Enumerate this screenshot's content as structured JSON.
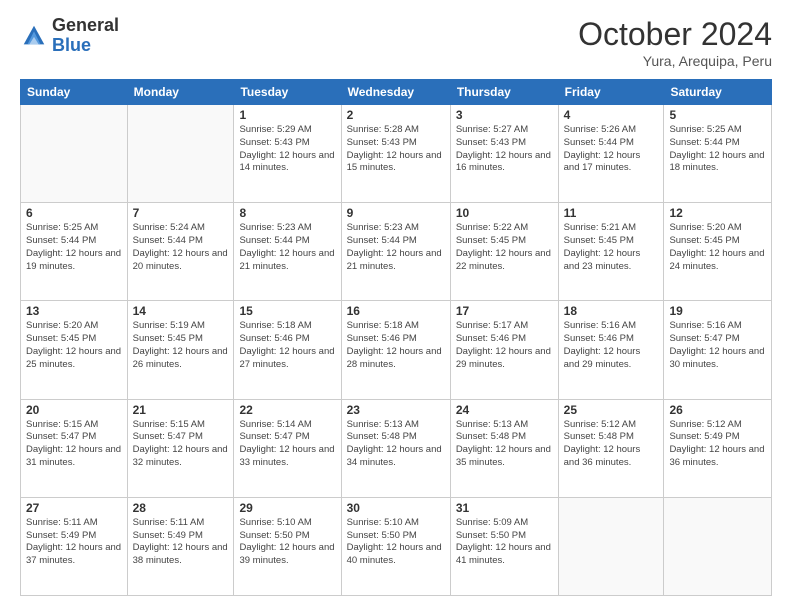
{
  "header": {
    "logo_general": "General",
    "logo_blue": "Blue",
    "month_title": "October 2024",
    "location": "Yura, Arequipa, Peru"
  },
  "days_of_week": [
    "Sunday",
    "Monday",
    "Tuesday",
    "Wednesday",
    "Thursday",
    "Friday",
    "Saturday"
  ],
  "weeks": [
    [
      {
        "day": "",
        "info": ""
      },
      {
        "day": "",
        "info": ""
      },
      {
        "day": "1",
        "sunrise": "5:29 AM",
        "sunset": "5:43 PM",
        "daylight": "12 hours and 14 minutes."
      },
      {
        "day": "2",
        "sunrise": "5:28 AM",
        "sunset": "5:43 PM",
        "daylight": "12 hours and 15 minutes."
      },
      {
        "day": "3",
        "sunrise": "5:27 AM",
        "sunset": "5:43 PM",
        "daylight": "12 hours and 16 minutes."
      },
      {
        "day": "4",
        "sunrise": "5:26 AM",
        "sunset": "5:44 PM",
        "daylight": "12 hours and 17 minutes."
      },
      {
        "day": "5",
        "sunrise": "5:25 AM",
        "sunset": "5:44 PM",
        "daylight": "12 hours and 18 minutes."
      }
    ],
    [
      {
        "day": "6",
        "sunrise": "5:25 AM",
        "sunset": "5:44 PM",
        "daylight": "12 hours and 19 minutes."
      },
      {
        "day": "7",
        "sunrise": "5:24 AM",
        "sunset": "5:44 PM",
        "daylight": "12 hours and 20 minutes."
      },
      {
        "day": "8",
        "sunrise": "5:23 AM",
        "sunset": "5:44 PM",
        "daylight": "12 hours and 21 minutes."
      },
      {
        "day": "9",
        "sunrise": "5:23 AM",
        "sunset": "5:44 PM",
        "daylight": "12 hours and 21 minutes."
      },
      {
        "day": "10",
        "sunrise": "5:22 AM",
        "sunset": "5:45 PM",
        "daylight": "12 hours and 22 minutes."
      },
      {
        "day": "11",
        "sunrise": "5:21 AM",
        "sunset": "5:45 PM",
        "daylight": "12 hours and 23 minutes."
      },
      {
        "day": "12",
        "sunrise": "5:20 AM",
        "sunset": "5:45 PM",
        "daylight": "12 hours and 24 minutes."
      }
    ],
    [
      {
        "day": "13",
        "sunrise": "5:20 AM",
        "sunset": "5:45 PM",
        "daylight": "12 hours and 25 minutes."
      },
      {
        "day": "14",
        "sunrise": "5:19 AM",
        "sunset": "5:45 PM",
        "daylight": "12 hours and 26 minutes."
      },
      {
        "day": "15",
        "sunrise": "5:18 AM",
        "sunset": "5:46 PM",
        "daylight": "12 hours and 27 minutes."
      },
      {
        "day": "16",
        "sunrise": "5:18 AM",
        "sunset": "5:46 PM",
        "daylight": "12 hours and 28 minutes."
      },
      {
        "day": "17",
        "sunrise": "5:17 AM",
        "sunset": "5:46 PM",
        "daylight": "12 hours and 29 minutes."
      },
      {
        "day": "18",
        "sunrise": "5:16 AM",
        "sunset": "5:46 PM",
        "daylight": "12 hours and 29 minutes."
      },
      {
        "day": "19",
        "sunrise": "5:16 AM",
        "sunset": "5:47 PM",
        "daylight": "12 hours and 30 minutes."
      }
    ],
    [
      {
        "day": "20",
        "sunrise": "5:15 AM",
        "sunset": "5:47 PM",
        "daylight": "12 hours and 31 minutes."
      },
      {
        "day": "21",
        "sunrise": "5:15 AM",
        "sunset": "5:47 PM",
        "daylight": "12 hours and 32 minutes."
      },
      {
        "day": "22",
        "sunrise": "5:14 AM",
        "sunset": "5:47 PM",
        "daylight": "12 hours and 33 minutes."
      },
      {
        "day": "23",
        "sunrise": "5:13 AM",
        "sunset": "5:48 PM",
        "daylight": "12 hours and 34 minutes."
      },
      {
        "day": "24",
        "sunrise": "5:13 AM",
        "sunset": "5:48 PM",
        "daylight": "12 hours and 35 minutes."
      },
      {
        "day": "25",
        "sunrise": "5:12 AM",
        "sunset": "5:48 PM",
        "daylight": "12 hours and 36 minutes."
      },
      {
        "day": "26",
        "sunrise": "5:12 AM",
        "sunset": "5:49 PM",
        "daylight": "12 hours and 36 minutes."
      }
    ],
    [
      {
        "day": "27",
        "sunrise": "5:11 AM",
        "sunset": "5:49 PM",
        "daylight": "12 hours and 37 minutes."
      },
      {
        "day": "28",
        "sunrise": "5:11 AM",
        "sunset": "5:49 PM",
        "daylight": "12 hours and 38 minutes."
      },
      {
        "day": "29",
        "sunrise": "5:10 AM",
        "sunset": "5:50 PM",
        "daylight": "12 hours and 39 minutes."
      },
      {
        "day": "30",
        "sunrise": "5:10 AM",
        "sunset": "5:50 PM",
        "daylight": "12 hours and 40 minutes."
      },
      {
        "day": "31",
        "sunrise": "5:09 AM",
        "sunset": "5:50 PM",
        "daylight": "12 hours and 41 minutes."
      },
      {
        "day": "",
        "info": ""
      },
      {
        "day": "",
        "info": ""
      }
    ]
  ]
}
